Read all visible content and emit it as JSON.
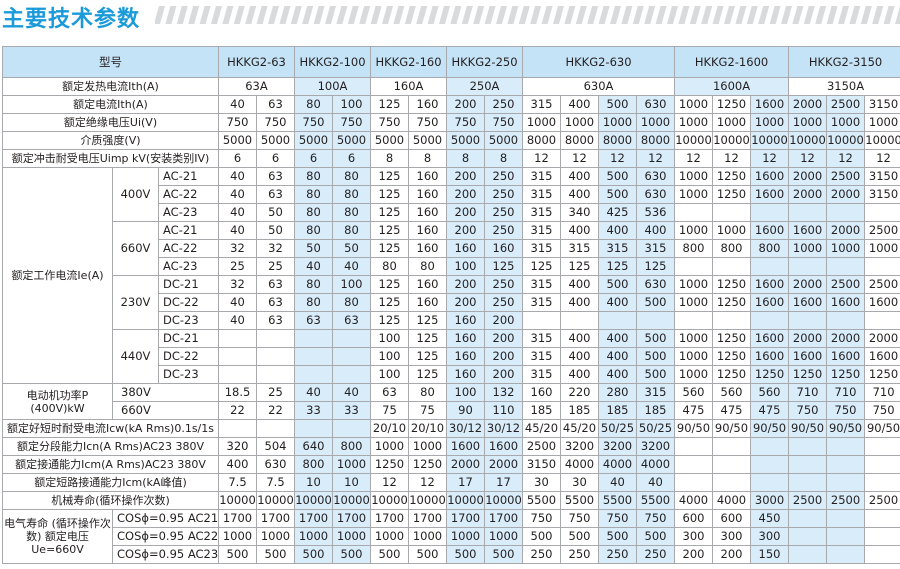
{
  "title": "主要技术参数",
  "table": {
    "header": {
      "label": "型号",
      "models": [
        "HKKG2-63",
        "HKKG2-100",
        "HKKG2-160",
        "HKKG2-250",
        "HKKG2-630",
        "HKKG2-1600",
        "HKKG2-3150"
      ]
    },
    "ith": {
      "label": "额定发热电流Ith(A)",
      "values": [
        "63A",
        "100A",
        "160A",
        "250A",
        "630A",
        "1600A",
        "3150A"
      ]
    },
    "simple_rows": [
      {
        "label": "额定电流Ith(A)",
        "values": [
          "40",
          "63",
          "80",
          "100",
          "125",
          "160",
          "200",
          "250",
          "315",
          "400",
          "500",
          "630",
          "1000",
          "1250",
          "1600",
          "2000",
          "2500",
          "3150"
        ]
      },
      {
        "label": "额定绝缘电压Ui(V)",
        "values": [
          "750",
          "750",
          "750",
          "750",
          "750",
          "750",
          "750",
          "750",
          "1000",
          "1000",
          "1000",
          "1000",
          "1000",
          "1000",
          "1000",
          "1000",
          "1000",
          "1000"
        ]
      },
      {
        "label": "介质强度(V)",
        "values": [
          "5000",
          "5000",
          "5000",
          "5000",
          "5000",
          "5000",
          "5000",
          "5000",
          "8000",
          "8000",
          "8000",
          "8000",
          "10000",
          "10000",
          "10000",
          "10000",
          "10000",
          "10000"
        ]
      },
      {
        "label": "额定冲击耐受电压Uimp kV(安装类别IV)",
        "values": [
          "6",
          "6",
          "6",
          "6",
          "8",
          "8",
          "8",
          "8",
          "12",
          "12",
          "12",
          "12",
          "12",
          "12",
          "12",
          "12",
          "12",
          "12"
        ]
      }
    ],
    "ie": {
      "label": "额定工作电流Ie(A)",
      "groups": [
        {
          "voltage": "400V",
          "rows": [
            {
              "cat": "AC-21",
              "values": [
                "40",
                "63",
                "80",
                "80",
                "125",
                "160",
                "200",
                "250",
                "315",
                "400",
                "500",
                "630",
                "1000",
                "1250",
                "1600",
                "2000",
                "2500",
                "3150"
              ]
            },
            {
              "cat": "AC-22",
              "values": [
                "40",
                "63",
                "80",
                "80",
                "125",
                "160",
                "200",
                "250",
                "315",
                "400",
                "500",
                "630",
                "1000",
                "1250",
                "1600",
                "2000",
                "2000",
                "3150"
              ]
            },
            {
              "cat": "AC-23",
              "values": [
                "40",
                "50",
                "80",
                "80",
                "125",
                "160",
                "200",
                "250",
                "315",
                "340",
                "425",
                "536",
                "",
                "",
                "",
                "",
                "",
                ""
              ]
            }
          ]
        },
        {
          "voltage": "660V",
          "rows": [
            {
              "cat": "AC-21",
              "values": [
                "40",
                "50",
                "80",
                "80",
                "125",
                "160",
                "200",
                "250",
                "315",
                "400",
                "400",
                "400",
                "1000",
                "1000",
                "1600",
                "1600",
                "2000",
                "2500"
              ]
            },
            {
              "cat": "AC-22",
              "values": [
                "32",
                "32",
                "50",
                "50",
                "125",
                "160",
                "160",
                "160",
                "315",
                "315",
                "315",
                "315",
                "800",
                "800",
                "800",
                "1000",
                "1000",
                "1000"
              ]
            },
            {
              "cat": "AC-23",
              "values": [
                "25",
                "25",
                "40",
                "40",
                "80",
                "80",
                "100",
                "125",
                "125",
                "125",
                "125",
                "125",
                "",
                "",
                "",
                "",
                "",
                ""
              ]
            }
          ]
        },
        {
          "voltage": "230V",
          "rows": [
            {
              "cat": "DC-21",
              "values": [
                "32",
                "63",
                "80",
                "100",
                "125",
                "160",
                "200",
                "250",
                "315",
                "400",
                "500",
                "630",
                "1000",
                "1250",
                "1600",
                "2000",
                "2500",
                "2500"
              ]
            },
            {
              "cat": "DC-22",
              "values": [
                "40",
                "63",
                "80",
                "80",
                "125",
                "160",
                "200",
                "250",
                "315",
                "400",
                "400",
                "500",
                "1000",
                "1250",
                "1600",
                "1600",
                "1600",
                "1600"
              ]
            },
            {
              "cat": "DC-23",
              "values": [
                "40",
                "63",
                "63",
                "63",
                "125",
                "125",
                "160",
                "200",
                "",
                "",
                "",
                "",
                "",
                "",
                "",
                "",
                "",
                ""
              ]
            }
          ]
        },
        {
          "voltage": "440V",
          "rows": [
            {
              "cat": "DC-21",
              "values": [
                "",
                "",
                "",
                "",
                "100",
                "125",
                "160",
                "200",
                "315",
                "400",
                "400",
                "500",
                "1000",
                "1250",
                "1600",
                "2000",
                "2000",
                "2000"
              ]
            },
            {
              "cat": "DC-22",
              "values": [
                "",
                "",
                "",
                "",
                "100",
                "125",
                "160",
                "200",
                "315",
                "400",
                "400",
                "500",
                "1000",
                "1250",
                "1600",
                "1600",
                "1600",
                "1600"
              ]
            },
            {
              "cat": "DC-23",
              "values": [
                "",
                "",
                "",
                "",
                "100",
                "125",
                "160",
                "200",
                "315",
                "400",
                "400",
                "500",
                "1000",
                "1250",
                "1250",
                "1250",
                "1250",
                "1250"
              ]
            }
          ]
        }
      ]
    },
    "motor": {
      "label": "电动机功率P (400V)kW",
      "rows": [
        {
          "voltage": "380V",
          "values": [
            "18.5",
            "25",
            "40",
            "40",
            "63",
            "80",
            "100",
            "132",
            "160",
            "220",
            "280",
            "315",
            "560",
            "560",
            "560",
            "710",
            "710",
            "710"
          ]
        },
        {
          "voltage": "660V",
          "values": [
            "22",
            "22",
            "33",
            "33",
            "75",
            "75",
            "90",
            "110",
            "185",
            "185",
            "185",
            "185",
            "475",
            "475",
            "475",
            "750",
            "750",
            "750"
          ]
        }
      ]
    },
    "icw": {
      "label": "额定好短时耐受电流Icw(kA Rms)0.1s/1s",
      "values": [
        "",
        "",
        "",
        "",
        "20/10",
        "20/10",
        "30/12",
        "30/12",
        "45/20",
        "45/20",
        "50/25",
        "50/25",
        "90/50",
        "90/50",
        "90/50",
        "90/50",
        "90/50",
        "90/50"
      ]
    },
    "bottom_rows": [
      {
        "label": "额定分段能力Icn(A Rms)AC23 380V",
        "values": [
          "320",
          "504",
          "640",
          "800",
          "1000",
          "1000",
          "1600",
          "1600",
          "2500",
          "3200",
          "3200",
          "3200",
          "",
          "",
          "",
          "",
          "",
          ""
        ]
      },
      {
        "label": "额定接通能力Icm(A Rms)AC23 380V",
        "values": [
          "400",
          "630",
          "800",
          "1000",
          "1250",
          "1250",
          "2000",
          "2000",
          "3150",
          "4000",
          "4000",
          "4000",
          "",
          "",
          "",
          "",
          "",
          ""
        ]
      },
      {
        "label": "额定短路接通能力Icm(kA峰值)",
        "values": [
          "7.5",
          "7.5",
          "10",
          "10",
          "12",
          "12",
          "17",
          "17",
          "30",
          "30",
          "40",
          "40",
          "",
          "",
          "",
          "",
          "",
          ""
        ]
      },
      {
        "label": "机械寿命(循环操作次数)",
        "values": [
          "10000",
          "10000",
          "10000",
          "10000",
          "10000",
          "10000",
          "10000",
          "10000",
          "5500",
          "5500",
          "5500",
          "5500",
          "4000",
          "4000",
          "3000",
          "2500",
          "2500",
          "2500"
        ]
      }
    ],
    "electrical_life": {
      "label": "电气寿命 (循环操作次数) 额定电压Ue=660V",
      "rows": [
        {
          "cond": "COSϕ=0.95 AC21",
          "values": [
            "1700",
            "1700",
            "1700",
            "1700",
            "1700",
            "1700",
            "1700",
            "1700",
            "750",
            "750",
            "750",
            "750",
            "600",
            "600",
            "450",
            "",
            "",
            ""
          ]
        },
        {
          "cond": "COSϕ=0.95 AC22",
          "values": [
            "1000",
            "1000",
            "1000",
            "1000",
            "1000",
            "1000",
            "1000",
            "1000",
            "500",
            "500",
            "500",
            "500",
            "300",
            "300",
            "300",
            "",
            "",
            ""
          ]
        },
        {
          "cond": "COSϕ=0.95 AC23",
          "values": [
            "500",
            "500",
            "500",
            "500",
            "500",
            "500",
            "500",
            "500",
            "250",
            "250",
            "250",
            "250",
            "200",
            "200",
            "150",
            "",
            "",
            ""
          ]
        }
      ]
    }
  }
}
